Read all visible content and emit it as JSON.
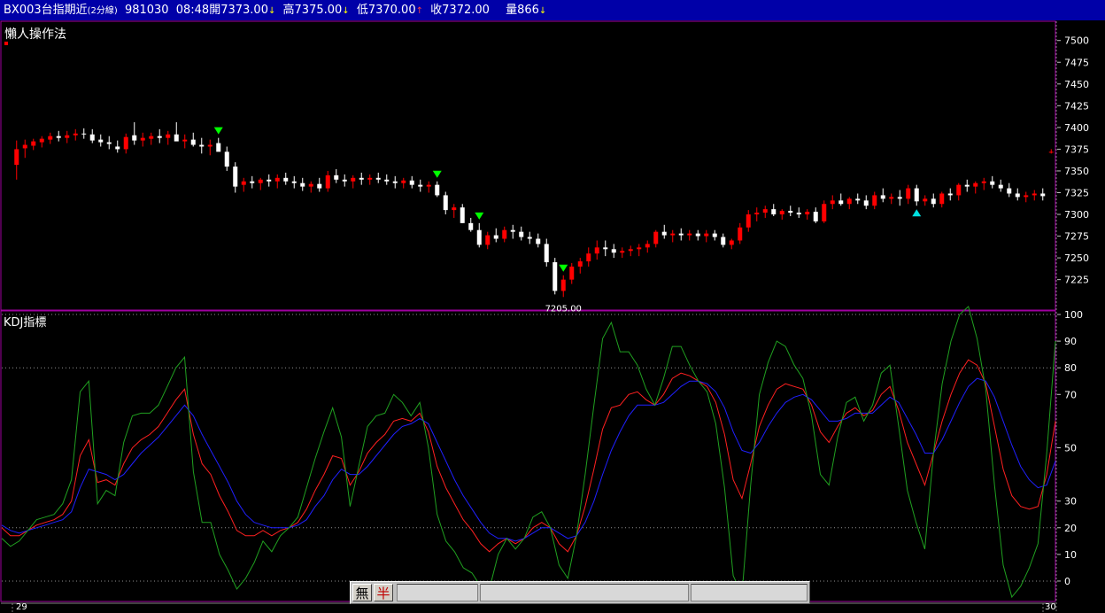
{
  "header": {
    "symbol": "BX003台指期近",
    "interval": "(2分線)",
    "date": "981030",
    "time": "08:48",
    "open_label": "開",
    "open": "7373.00",
    "high_label": "高",
    "high": "7375.00",
    "low_label": "低",
    "low": "7370.00",
    "close_label": "收",
    "close": "7372.00",
    "volume_label": "量",
    "volume": "866",
    "down_arrow": "↓",
    "up_arrow": "↑"
  },
  "price_panel": {
    "title": "懶人操作法",
    "low_annotation": "7205.00"
  },
  "kdj_panel": {
    "title": "KDJ指標"
  },
  "x_axis": {
    "start_label": "29",
    "end_label": "30"
  },
  "toolbar": {
    "btn1": "無",
    "btn2": "半"
  },
  "colors": {
    "frame": "#a000a0",
    "up_candle": "#ff0000",
    "down_candle": "#ffffff",
    "k_line": "#ff2020",
    "d_line": "#2020ff",
    "j_line": "#20a020",
    "sell_signal": "#00ff00",
    "buy_signal": "#00e0e0"
  },
  "chart_data": [
    {
      "type": "candlestick",
      "title": "懶人操作法",
      "ylim": [
        7190,
        7515
      ],
      "yticks": [
        7225,
        7250,
        7275,
        7300,
        7325,
        7350,
        7375,
        7400,
        7425,
        7450,
        7475,
        7500
      ],
      "candles": [
        [
          7357,
          7385,
          7340,
          7375
        ],
        [
          7376,
          7386,
          7365,
          7380
        ],
        [
          7379,
          7387,
          7374,
          7384
        ],
        [
          7383,
          7390,
          7377,
          7387
        ],
        [
          7386,
          7394,
          7381,
          7390
        ],
        [
          7390,
          7396,
          7384,
          7388
        ],
        [
          7388,
          7396,
          7382,
          7391
        ],
        [
          7391,
          7398,
          7385,
          7393
        ],
        [
          7393,
          7399,
          7387,
          7392
        ],
        [
          7392,
          7398,
          7382,
          7385
        ],
        [
          7386,
          7392,
          7378,
          7383
        ],
        [
          7383,
          7390,
          7375,
          7381
        ],
        [
          7378,
          7385,
          7371,
          7375
        ],
        [
          7375,
          7393,
          7370,
          7389
        ],
        [
          7391,
          7406,
          7380,
          7385
        ],
        [
          7385,
          7394,
          7378,
          7388
        ],
        [
          7387,
          7394,
          7380,
          7390
        ],
        [
          7390,
          7398,
          7382,
          7388
        ],
        [
          7388,
          7396,
          7380,
          7392
        ],
        [
          7392,
          7406,
          7386,
          7384
        ],
        [
          7384,
          7392,
          7376,
          7386
        ],
        [
          7386,
          7394,
          7378,
          7380
        ],
        [
          7380,
          7388,
          7370,
          7378
        ],
        [
          7378,
          7386,
          7368,
          7380
        ],
        [
          7382,
          7388,
          7375,
          7372
        ],
        [
          7372,
          7378,
          7350,
          7355
        ],
        [
          7355,
          7360,
          7325,
          7332
        ],
        [
          7334,
          7342,
          7326,
          7338
        ],
        [
          7338,
          7344,
          7330,
          7336
        ],
        [
          7336,
          7342,
          7328,
          7340
        ],
        [
          7340,
          7346,
          7332,
          7338
        ],
        [
          7338,
          7346,
          7330,
          7342
        ],
        [
          7342,
          7348,
          7334,
          7338
        ],
        [
          7338,
          7344,
          7330,
          7336
        ],
        [
          7336,
          7342,
          7327,
          7332
        ],
        [
          7332,
          7338,
          7325,
          7335
        ],
        [
          7335,
          7342,
          7326,
          7330
        ],
        [
          7330,
          7350,
          7326,
          7345
        ],
        [
          7345,
          7352,
          7336,
          7340
        ],
        [
          7340,
          7346,
          7332,
          7338
        ],
        [
          7338,
          7345,
          7330,
          7342
        ],
        [
          7342,
          7348,
          7334,
          7340
        ],
        [
          7340,
          7346,
          7334,
          7342
        ],
        [
          7342,
          7348,
          7336,
          7340
        ],
        [
          7340,
          7346,
          7334,
          7338
        ],
        [
          7338,
          7344,
          7330,
          7336
        ],
        [
          7336,
          7342,
          7330,
          7339
        ],
        [
          7339,
          7344,
          7330,
          7334
        ],
        [
          7334,
          7340,
          7326,
          7332
        ],
        [
          7332,
          7338,
          7325,
          7334
        ],
        [
          7334,
          7338,
          7320,
          7322
        ],
        [
          7322,
          7326,
          7300,
          7305
        ],
        [
          7305,
          7312,
          7296,
          7308
        ],
        [
          7308,
          7312,
          7290,
          7290
        ],
        [
          7290,
          7296,
          7280,
          7282
        ],
        [
          7282,
          7290,
          7262,
          7265
        ],
        [
          7265,
          7280,
          7260,
          7276
        ],
        [
          7276,
          7284,
          7268,
          7272
        ],
        [
          7272,
          7286,
          7268,
          7282
        ],
        [
          7282,
          7288,
          7272,
          7280
        ],
        [
          7280,
          7286,
          7270,
          7274
        ],
        [
          7274,
          7280,
          7266,
          7272
        ],
        [
          7272,
          7278,
          7262,
          7266
        ],
        [
          7266,
          7272,
          7240,
          7245
        ],
        [
          7245,
          7250,
          7208,
          7212
        ],
        [
          7212,
          7230,
          7205,
          7225
        ],
        [
          7225,
          7244,
          7220,
          7240
        ],
        [
          7240,
          7250,
          7232,
          7246
        ],
        [
          7246,
          7262,
          7240,
          7255
        ],
        [
          7255,
          7270,
          7248,
          7262
        ],
        [
          7262,
          7270,
          7252,
          7260
        ],
        [
          7260,
          7266,
          7250,
          7256
        ],
        [
          7256,
          7262,
          7250,
          7258
        ],
        [
          7258,
          7264,
          7252,
          7260
        ],
        [
          7260,
          7266,
          7252,
          7262
        ],
        [
          7262,
          7270,
          7256,
          7266
        ],
        [
          7266,
          7282,
          7262,
          7280
        ],
        [
          7280,
          7288,
          7272,
          7276
        ],
        [
          7276,
          7282,
          7268,
          7278
        ],
        [
          7278,
          7284,
          7270,
          7276
        ],
        [
          7276,
          7282,
          7270,
          7278
        ],
        [
          7278,
          7282,
          7270,
          7275
        ],
        [
          7275,
          7282,
          7268,
          7278
        ],
        [
          7278,
          7282,
          7270,
          7274
        ],
        [
          7274,
          7278,
          7262,
          7265
        ],
        [
          7265,
          7272,
          7260,
          7270
        ],
        [
          7270,
          7290,
          7266,
          7285
        ],
        [
          7285,
          7305,
          7280,
          7300
        ],
        [
          7300,
          7308,
          7292,
          7302
        ],
        [
          7302,
          7310,
          7296,
          7306
        ],
        [
          7306,
          7312,
          7298,
          7300
        ],
        [
          7300,
          7306,
          7294,
          7304
        ],
        [
          7304,
          7310,
          7298,
          7302
        ],
        [
          7302,
          7308,
          7296,
          7300
        ],
        [
          7300,
          7306,
          7294,
          7303
        ],
        [
          7303,
          7308,
          7290,
          7292
        ],
        [
          7292,
          7316,
          7290,
          7312
        ],
        [
          7312,
          7322,
          7306,
          7316
        ],
        [
          7316,
          7324,
          7310,
          7312
        ],
        [
          7312,
          7320,
          7306,
          7318
        ],
        [
          7318,
          7324,
          7312,
          7316
        ],
        [
          7316,
          7322,
          7306,
          7310
        ],
        [
          7310,
          7326,
          7306,
          7322
        ],
        [
          7322,
          7330,
          7314,
          7318
        ],
        [
          7318,
          7324,
          7312,
          7320
        ],
        [
          7320,
          7328,
          7310,
          7318
        ],
        [
          7318,
          7334,
          7312,
          7330
        ],
        [
          7330,
          7334,
          7310,
          7315
        ],
        [
          7315,
          7322,
          7310,
          7318
        ],
        [
          7318,
          7324,
          7308,
          7312
        ],
        [
          7312,
          7326,
          7308,
          7324
        ],
        [
          7324,
          7330,
          7316,
          7322
        ],
        [
          7322,
          7336,
          7316,
          7334
        ],
        [
          7334,
          7340,
          7326,
          7332
        ],
        [
          7332,
          7338,
          7324,
          7336
        ],
        [
          7336,
          7342,
          7328,
          7338
        ],
        [
          7338,
          7344,
          7330,
          7334
        ],
        [
          7334,
          7340,
          7326,
          7330
        ],
        [
          7330,
          7336,
          7320,
          7324
        ],
        [
          7324,
          7330,
          7316,
          7320
        ],
        [
          7320,
          7326,
          7314,
          7322
        ],
        [
          7322,
          7328,
          7316,
          7324
        ],
        [
          7324,
          7330,
          7316,
          7321
        ],
        [
          7372,
          7375,
          7370,
          7372
        ]
      ],
      "sell_signals": [
        24,
        50,
        55,
        65
      ],
      "buy_signals": [
        107
      ],
      "low_label_index": 65
    },
    {
      "type": "line",
      "title": "KDJ指標",
      "ylim": [
        -5,
        100
      ],
      "yticks": [
        0,
        10,
        20,
        30,
        50,
        70,
        80,
        90,
        100
      ],
      "series": [
        {
          "name": "",
          "values": [
            20,
            17,
            17,
            19,
            21,
            22,
            23,
            25,
            30,
            47,
            53,
            37,
            38,
            36,
            44,
            50,
            53,
            55,
            58,
            63,
            68,
            72,
            55,
            44,
            40,
            32,
            26,
            19,
            17,
            17,
            19,
            17,
            19,
            20,
            22,
            27,
            34,
            40,
            47,
            46,
            36,
            41,
            48,
            52,
            55,
            60,
            61,
            60,
            63,
            56,
            43,
            35,
            29,
            23,
            19,
            14,
            11,
            14,
            16,
            14,
            16,
            20,
            22,
            20,
            14,
            11,
            17,
            28,
            42,
            57,
            65,
            66,
            70,
            71,
            68,
            66,
            70,
            76,
            78,
            77,
            75,
            73,
            67,
            55,
            38,
            31,
            44,
            58,
            66,
            72,
            74,
            73,
            72,
            66,
            56,
            52,
            58,
            63,
            65,
            62,
            64,
            70,
            73,
            64,
            52,
            44,
            36,
            48,
            60,
            70,
            78,
            83,
            81,
            74,
            58,
            42,
            32,
            28,
            27,
            28,
            40,
            60
          ]
        },
        {
          "name": "",
          "values": [
            21,
            19,
            18,
            19,
            20,
            21,
            22,
            23,
            26,
            35,
            42,
            41,
            40,
            38,
            40,
            44,
            48,
            51,
            54,
            58,
            62,
            66,
            62,
            55,
            49,
            43,
            37,
            30,
            25,
            22,
            21,
            20,
            20,
            20,
            21,
            23,
            28,
            32,
            38,
            42,
            40,
            40,
            43,
            47,
            51,
            55,
            58,
            59,
            61,
            59,
            52,
            45,
            38,
            32,
            27,
            22,
            18,
            16,
            16,
            15,
            16,
            18,
            20,
            20,
            18,
            16,
            17,
            22,
            30,
            40,
            49,
            56,
            62,
            66,
            66,
            66,
            67,
            70,
            73,
            75,
            75,
            74,
            71,
            65,
            56,
            49,
            48,
            52,
            58,
            63,
            67,
            69,
            70,
            68,
            64,
            60,
            60,
            61,
            63,
            63,
            63,
            66,
            69,
            67,
            61,
            55,
            48,
            48,
            53,
            60,
            67,
            73,
            76,
            75,
            69,
            60,
            51,
            43,
            38,
            35,
            36,
            45
          ]
        },
        {
          "name": "",
          "values": [
            16,
            13,
            15,
            19,
            23,
            24,
            25,
            29,
            38,
            71,
            75,
            29,
            34,
            32,
            52,
            62,
            63,
            63,
            66,
            73,
            80,
            84,
            41,
            22,
            22,
            10,
            4,
            -3,
            1,
            7,
            15,
            11,
            17,
            20,
            24,
            35,
            46,
            56,
            65,
            54,
            28,
            43,
            58,
            62,
            63,
            70,
            67,
            62,
            67,
            50,
            25,
            15,
            11,
            5,
            3,
            -2,
            -3,
            10,
            16,
            12,
            16,
            24,
            26,
            20,
            6,
            1,
            17,
            40,
            66,
            91,
            97,
            86,
            86,
            81,
            72,
            66,
            76,
            88,
            88,
            81,
            75,
            71,
            59,
            35,
            2,
            -5,
            36,
            70,
            82,
            90,
            88,
            81,
            76,
            62,
            40,
            36,
            54,
            67,
            69,
            60,
            66,
            78,
            81,
            58,
            34,
            22,
            12,
            48,
            74,
            90,
            100,
            103,
            91,
            72,
            36,
            6,
            -6,
            -2,
            5,
            14,
            48,
            90
          ]
        }
      ]
    }
  ]
}
